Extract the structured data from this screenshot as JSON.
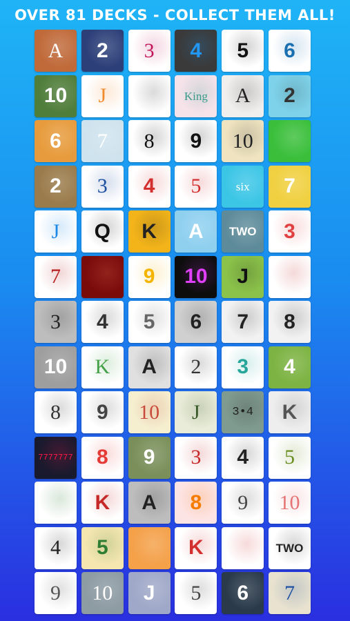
{
  "header": {
    "title": "OVER 81 DECKS - COLLECT THEM ALL!"
  },
  "decks": [
    [
      {
        "label": "A",
        "bg": "#c06a3a",
        "fg": "#ffffff",
        "style": "serif",
        "icon": "forest-icon"
      },
      {
        "label": "2",
        "bg": "#2c3f78",
        "fg": "#ffffff",
        "style": "sans",
        "icon": "jack-card-icon"
      },
      {
        "label": "3",
        "bg": "#ffffff",
        "fg": "#c2185b",
        "style": "serif",
        "icon": "dice-icon"
      },
      {
        "label": "4",
        "bg": "#3a3a3a",
        "fg": "#2196f3",
        "style": "sans",
        "icon": "number-icon"
      },
      {
        "label": "5",
        "bg": "#ffffff",
        "fg": "#111111",
        "style": "sans",
        "icon": "eight-ball-icon"
      },
      {
        "label": "6",
        "bg": "#ffffff",
        "fg": "#1a6fb0",
        "style": "sans",
        "icon": "guitar-icon"
      }
    ],
    [
      {
        "label": "10",
        "bg": "#4f7d3a",
        "fg": "#ffffff",
        "style": "sans",
        "icon": "golf-course-icon"
      },
      {
        "label": "J",
        "bg": "#ffffff",
        "fg": "#f08a2c",
        "style": "serif",
        "icon": "letter-icon"
      },
      {
        "label": "",
        "bg": "#ffffff",
        "fg": "#333333",
        "style": "serif",
        "icon": "necktie-icon"
      },
      {
        "label": "King",
        "bg": "#f6e3ea",
        "fg": "#3a9a8a",
        "style": "serif",
        "icon": "rose-icon"
      },
      {
        "label": "A",
        "bg": "#f1eeee",
        "fg": "#222222",
        "style": "serif",
        "icon": "letter-icon"
      },
      {
        "label": "2",
        "bg": "#7ed3ea",
        "fg": "#333333",
        "style": "sans",
        "icon": "pool-icon"
      }
    ],
    [
      {
        "label": "6",
        "bg": "#e79b3c",
        "fg": "#ffffff",
        "style": "sans",
        "icon": "landscape-icon"
      },
      {
        "label": "7",
        "bg": "#cfe3ee",
        "fg": "#ffffff",
        "style": "serif",
        "icon": "flower-icon"
      },
      {
        "label": "8",
        "bg": "#ffffff",
        "fg": "#111111",
        "style": "serif",
        "icon": "text-icon"
      },
      {
        "label": "9",
        "bg": "#ffffff",
        "fg": "#111111",
        "style": "sans",
        "icon": "face-icon"
      },
      {
        "label": "10",
        "bg": "#efe3c0",
        "fg": "#222222",
        "style": "serif",
        "icon": "vintage-icon"
      },
      {
        "label": "",
        "bg": "#3bbf3b",
        "fg": "#ffffff",
        "style": "serif",
        "icon": "celtic-knot-icon"
      }
    ],
    [
      {
        "label": "2",
        "bg": "#9a7b4b",
        "fg": "#ffffff",
        "style": "sans",
        "icon": "graffiti-icon"
      },
      {
        "label": "3",
        "bg": "#ffffff",
        "fg": "#1d4fa0",
        "style": "serif",
        "icon": "number-icon"
      },
      {
        "label": "4",
        "bg": "#ffffff",
        "fg": "#d32f2f",
        "style": "sans",
        "icon": "arrow-icon"
      },
      {
        "label": "5",
        "bg": "#ffffff",
        "fg": "#d32f2f",
        "style": "serif",
        "icon": "number-icon"
      },
      {
        "label": "six",
        "bg": "#3cc6e6",
        "fg": "#ffffff",
        "style": "serif",
        "icon": "script-icon"
      },
      {
        "label": "7",
        "bg": "#f0d040",
        "fg": "#ffffff",
        "style": "sans",
        "icon": "number-icon"
      }
    ],
    [
      {
        "label": "J",
        "bg": "#ffffff",
        "fg": "#1e88e5",
        "style": "serif",
        "icon": "heart-icon"
      },
      {
        "label": "Q",
        "bg": "#ffffff",
        "fg": "#111111",
        "style": "sans",
        "icon": "bird-icon"
      },
      {
        "label": "K",
        "bg": "#f3b41a",
        "fg": "#222222",
        "style": "sans",
        "icon": "gold-icon"
      },
      {
        "label": "A",
        "bg": "#8fd0ef",
        "fg": "#ffffff",
        "style": "sans",
        "icon": "ice-icon"
      },
      {
        "label": "TWO",
        "bg": "#5e8b9a",
        "fg": "#ffffff",
        "style": "sans",
        "icon": "text-icon"
      },
      {
        "label": "3",
        "bg": "#ffffff",
        "fg": "#e04040",
        "style": "sans",
        "icon": "robot-icon"
      }
    ],
    [
      {
        "label": "7",
        "bg": "#ffffff",
        "fg": "#b71c1c",
        "style": "serif",
        "icon": "nutcracker-icon"
      },
      {
        "label": "",
        "bg": "#7a0b0b",
        "fg": "#ff8a65",
        "style": "sans",
        "icon": "fractal-icon"
      },
      {
        "label": "9",
        "bg": "#ffffff",
        "fg": "#f4b400",
        "style": "sans",
        "icon": "emoji-icon"
      },
      {
        "label": "10",
        "bg": "#0d0d0d",
        "fg": "#e040fb",
        "style": "sans",
        "icon": "neon-icon"
      },
      {
        "label": "J",
        "bg": "#8bc34a",
        "fg": "#111111",
        "style": "sans",
        "icon": "bat-icon"
      },
      {
        "label": "",
        "bg": "#ffffff",
        "fg": "#c62828",
        "style": "sans",
        "icon": "heart-tattoo-icon"
      }
    ],
    [
      {
        "label": "3",
        "bg": "#bdbdbd",
        "fg": "#222222",
        "style": "serif",
        "icon": "fly-icon"
      },
      {
        "label": "4",
        "bg": "#ffffff",
        "fg": "#333333",
        "style": "sans",
        "icon": "monkey-icon"
      },
      {
        "label": "5",
        "bg": "#ffffff",
        "fg": "#666666",
        "style": "sans",
        "icon": "ice-cream-icon"
      },
      {
        "label": "6",
        "bg": "#d0d0d0",
        "fg": "#222222",
        "style": "sans",
        "icon": "horse-icon"
      },
      {
        "label": "7",
        "bg": "#f2f2f2",
        "fg": "#222222",
        "style": "sans",
        "icon": "kitten-icon"
      },
      {
        "label": "8",
        "bg": "#f2f2f2",
        "fg": "#222222",
        "style": "sans",
        "icon": "puppy-icon"
      }
    ],
    [
      {
        "label": "10",
        "bg": "#9e9e9e",
        "fg": "#ffffff",
        "style": "sans",
        "icon": "stone-icon"
      },
      {
        "label": "K",
        "bg": "#ffffff",
        "fg": "#43a047",
        "style": "serif",
        "icon": "letter-icon"
      },
      {
        "label": "A",
        "bg": "#e0e0e0",
        "fg": "#222222",
        "style": "sans",
        "icon": "skull-icon"
      },
      {
        "label": "2",
        "bg": "#ffffff",
        "fg": "#333333",
        "style": "serif",
        "icon": "leaf-icon"
      },
      {
        "label": "3",
        "bg": "#ffffff",
        "fg": "#26a69a",
        "style": "sans",
        "icon": "club-icon"
      },
      {
        "label": "4",
        "bg": "#7cb342",
        "fg": "#ffffff",
        "style": "sans",
        "icon": "gradient-icon"
      }
    ],
    [
      {
        "label": "8",
        "bg": "#ffffff",
        "fg": "#333333",
        "style": "serif",
        "icon": "moon-icon"
      },
      {
        "label": "9",
        "bg": "#ffffff",
        "fg": "#444444",
        "style": "sans",
        "icon": "orbit-icon"
      },
      {
        "label": "10",
        "bg": "#f5efd0",
        "fg": "#c94a3a",
        "style": "serif",
        "icon": "floral-icon"
      },
      {
        "label": "J",
        "bg": "#e9ecd9",
        "fg": "#3a5a2a",
        "style": "serif",
        "icon": "money-icon"
      },
      {
        "label": "3•4",
        "bg": "#7f9a8f",
        "fg": "#222222",
        "style": "mono",
        "icon": "text-icon"
      },
      {
        "label": "K",
        "bg": "#eeeeee",
        "fg": "#555555",
        "style": "sans",
        "icon": "pattern-icon"
      }
    ],
    [
      {
        "label": "7777777",
        "bg": "#1a1a2e",
        "fg": "#ff1744",
        "style": "mono",
        "icon": "flag-icon"
      },
      {
        "label": "8",
        "bg": "#ffffff",
        "fg": "#e53935",
        "style": "sans",
        "icon": "candy-icon"
      },
      {
        "label": "9",
        "bg": "#7a8f5a",
        "fg": "#ffffff",
        "style": "sans",
        "icon": "temple-icon"
      },
      {
        "label": "3",
        "bg": "#ffffff",
        "fg": "#c62828",
        "style": "serif",
        "icon": "number-icon"
      },
      {
        "label": "4",
        "bg": "#ffffff",
        "fg": "#222222",
        "style": "sans",
        "icon": "h-icon"
      },
      {
        "label": "5",
        "bg": "#ffffff",
        "fg": "#6b8e23",
        "style": "serif",
        "icon": "lily-icon"
      }
    ],
    [
      {
        "label": "",
        "bg": "#ffffff",
        "fg": "#2e7d32",
        "style": "sans",
        "icon": "recycle-icon"
      },
      {
        "label": "K",
        "bg": "#ffffff",
        "fg": "#c62828",
        "style": "sans",
        "icon": "king-card-icon"
      },
      {
        "label": "A",
        "bg": "#bdbdbd",
        "fg": "#222222",
        "style": "sans",
        "icon": "letter-icon"
      },
      {
        "label": "8",
        "bg": "#fde4e4",
        "fg": "#f57c00",
        "style": "sans",
        "icon": "number-icon"
      },
      {
        "label": "9",
        "bg": "#ffffff",
        "fg": "#444444",
        "style": "serif",
        "icon": "gourd-icon"
      },
      {
        "label": "10",
        "bg": "#ffffff",
        "fg": "#e57373",
        "style": "serif",
        "icon": "bird-icon"
      }
    ],
    [
      {
        "label": "4",
        "bg": "#ffffff",
        "fg": "#222222",
        "style": "serif",
        "icon": "dancer-icon"
      },
      {
        "label": "5",
        "bg": "#f5e6b0",
        "fg": "#2e7d32",
        "style": "sans",
        "icon": "skateboarder-icon"
      },
      {
        "label": "",
        "bg": "#f4a14a",
        "fg": "#ffffff",
        "style": "sans",
        "icon": "hand-icon"
      },
      {
        "label": "K",
        "bg": "#ffffff",
        "fg": "#d32f2f",
        "style": "sans",
        "icon": "pizza-icon"
      },
      {
        "label": "",
        "bg": "#ffffff",
        "fg": "#d32f2f",
        "style": "sans",
        "icon": "sushi-icon"
      },
      {
        "label": "TWO",
        "bg": "#ffffff",
        "fg": "#222222",
        "style": "sans",
        "icon": "text-icon"
      }
    ],
    [
      {
        "label": "9",
        "bg": "#ffffff",
        "fg": "#555555",
        "style": "serif",
        "icon": "poodle-icon"
      },
      {
        "label": "10",
        "bg": "#8d9ba3",
        "fg": "#ffffff",
        "style": "serif",
        "icon": "harbor-icon"
      },
      {
        "label": "J",
        "bg": "#9fa8c8",
        "fg": "#ffffff",
        "style": "sans",
        "icon": "stamp-icon"
      },
      {
        "label": "5",
        "bg": "#ffffff",
        "fg": "#444444",
        "style": "serif",
        "icon": "cardinal-icon"
      },
      {
        "label": "6",
        "bg": "#2a3a4a",
        "fg": "#ffffff",
        "style": "sans",
        "icon": "lion-icon"
      },
      {
        "label": "7",
        "bg": "#e8e2cf",
        "fg": "#1e4fa0",
        "style": "serif",
        "icon": "club-icon"
      }
    ]
  ]
}
